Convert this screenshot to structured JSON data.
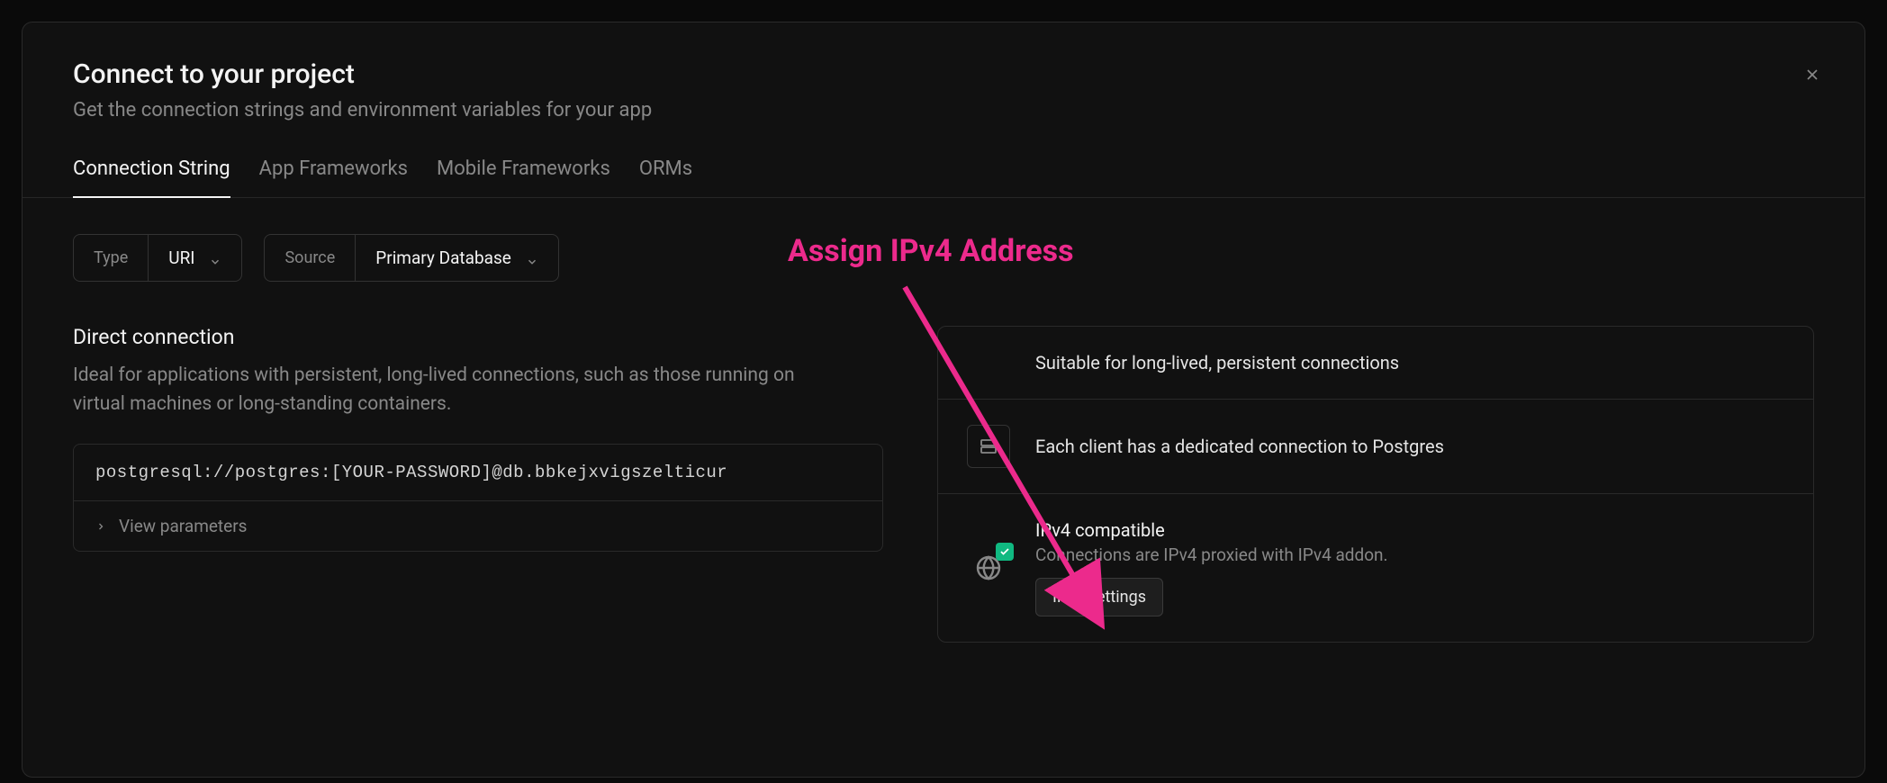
{
  "modal": {
    "title": "Connect to your project",
    "subtitle": "Get the connection strings and environment variables for your app"
  },
  "tabs": [
    {
      "label": "Connection String",
      "active": true
    },
    {
      "label": "App Frameworks",
      "active": false
    },
    {
      "label": "Mobile Frameworks",
      "active": false
    },
    {
      "label": "ORMs",
      "active": false
    }
  ],
  "selectors": {
    "type": {
      "label": "Type",
      "value": "URI"
    },
    "source": {
      "label": "Source",
      "value": "Primary Database"
    }
  },
  "direct": {
    "title": "Direct connection",
    "description": "Ideal for applications with persistent, long-lived connections, such as those running on virtual machines or long-standing containers.",
    "connection_string": "postgresql://postgres:[YOUR-PASSWORD]@db.bbkejxvigszelticur",
    "view_params_label": "View parameters"
  },
  "info": {
    "row1": "Suitable for long-lived, persistent connections",
    "row2": "Each client has a dedicated connection to Postgres",
    "row3": {
      "title": "IPv4 compatible",
      "subtitle": "Connections are IPv4 proxied with IPv4 addon.",
      "button": "IPv4 settings"
    }
  },
  "annotation": {
    "text": "Assign IPv4 Address"
  },
  "colors": {
    "accent_pink": "#ec2a8c",
    "accent_green": "#10b981"
  }
}
